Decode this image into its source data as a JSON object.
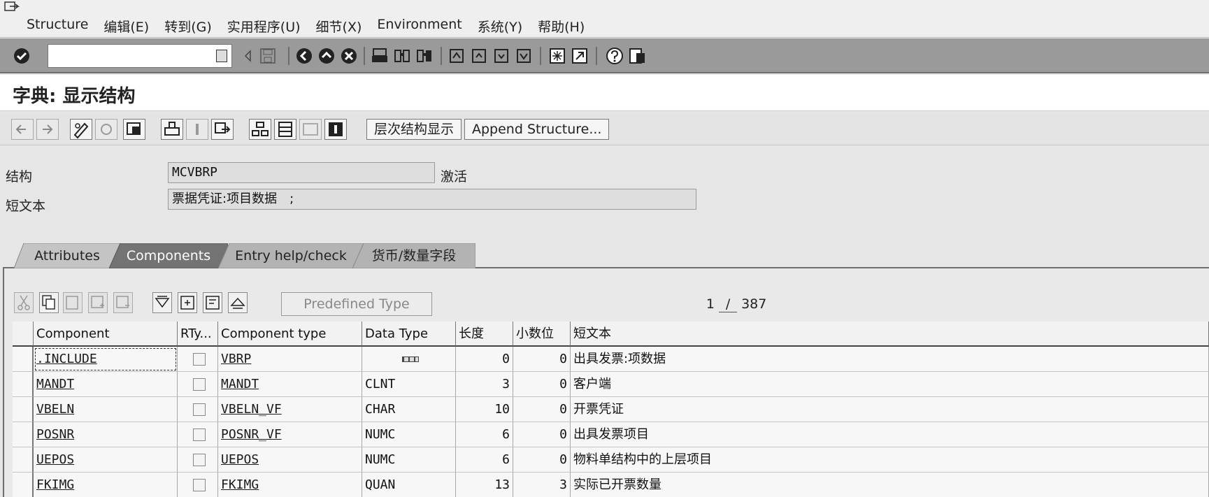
{
  "menu": {
    "items": [
      "Structure",
      "编辑(E)",
      "转到(G)",
      "实用程序(U)",
      "细节(X)",
      "Environment",
      "系统(Y)",
      "帮助(H)"
    ]
  },
  "toolbar": {
    "command_value": "",
    "icons": [
      "enter-icon",
      "save-icon",
      "back-icon",
      "exit-icon",
      "cancel-icon",
      "print-icon",
      "find-icon",
      "find-next-icon",
      "first-page-icon",
      "previous-page-icon",
      "next-page-icon",
      "last-page-icon",
      "new-session-icon",
      "shortcut-icon",
      "help-icon",
      "layout-icon"
    ]
  },
  "title": "字典: 显示结构",
  "app_toolbar": {
    "hierarchy_label": "层次结构显示",
    "append_label": "Append Structure..."
  },
  "header": {
    "structure_label": "结构",
    "structure_value": "MCVBRP",
    "status": "激活",
    "short_text_label": "短文本",
    "short_text_value": "票据凭证:项目数据　;"
  },
  "tabs": [
    "Attributes",
    "Components",
    "Entry help/check",
    "货币/数量字段"
  ],
  "active_tab": "Components",
  "table_toolbar": {
    "predefined_label": "Predefined Type",
    "page_current": "1",
    "page_sep": "/",
    "page_total": "387"
  },
  "columns": [
    "Component",
    "RTy...",
    "Component type",
    "Data Type",
    "长度",
    "小数位",
    "短文本"
  ],
  "rows": [
    {
      "component": ".INCLUDE",
      "rtype": false,
      "ctype": "VBRP",
      "dtype": "",
      "length": "0",
      "decimals": "0",
      "text": "出具发票:项数据"
    },
    {
      "component": "MANDT",
      "rtype": false,
      "ctype": "MANDT",
      "dtype": "CLNT",
      "length": "3",
      "decimals": "0",
      "text": "客户端"
    },
    {
      "component": "VBELN",
      "rtype": false,
      "ctype": "VBELN_VF",
      "dtype": "CHAR",
      "length": "10",
      "decimals": "0",
      "text": "开票凭证"
    },
    {
      "component": "POSNR",
      "rtype": false,
      "ctype": "POSNR_VF",
      "dtype": "NUMC",
      "length": "6",
      "decimals": "0",
      "text": "出具发票项目"
    },
    {
      "component": "UEPOS",
      "rtype": false,
      "ctype": "UEPOS",
      "dtype": "NUMC",
      "length": "6",
      "decimals": "0",
      "text": "物料单结构中的上层项目"
    },
    {
      "component": "FKIMG",
      "rtype": false,
      "ctype": "FKIMG",
      "dtype": "QUAN",
      "length": "13",
      "decimals": "3",
      "text": "实际已开票数量"
    }
  ]
}
